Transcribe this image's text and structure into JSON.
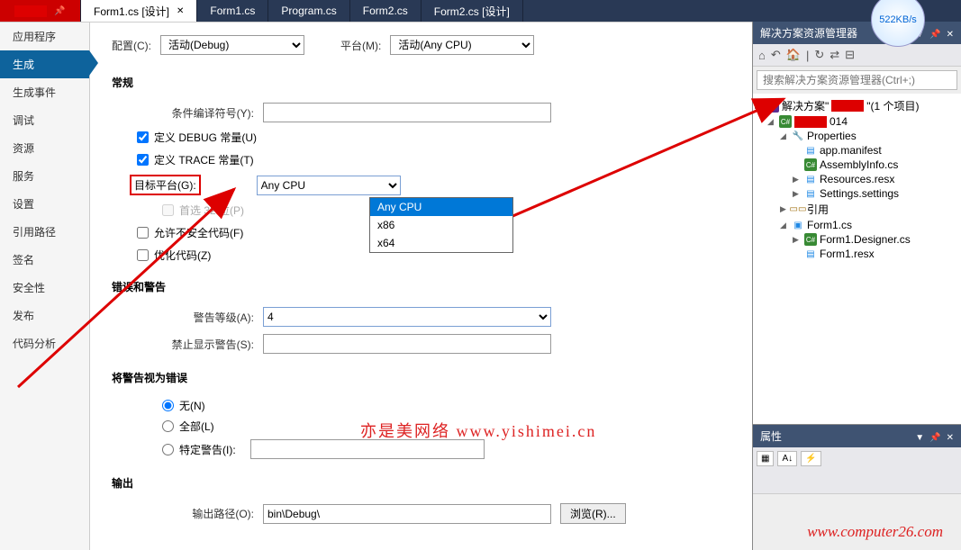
{
  "tabs": {
    "pinned_icon": "⬒",
    "items": [
      {
        "label": "Form1.cs [设计]",
        "active": true
      },
      {
        "label": "Form1.cs"
      },
      {
        "label": "Program.cs"
      },
      {
        "label": "Form2.cs"
      },
      {
        "label": "Form2.cs [设计]"
      }
    ]
  },
  "sidebar": {
    "items": [
      "应用程序",
      "生成",
      "生成事件",
      "调试",
      "资源",
      "服务",
      "设置",
      "引用路径",
      "签名",
      "安全性",
      "发布",
      "代码分析"
    ],
    "selected_index": 1
  },
  "config_bar": {
    "config_label": "配置(C):",
    "config_value": "活动(Debug)",
    "platform_label": "平台(M):",
    "platform_value": "活动(Any CPU)"
  },
  "sections": {
    "general": {
      "title": "常规",
      "cond_label": "条件编译符号(Y):",
      "cond_value": "",
      "define_debug": "定义 DEBUG 常量(U)",
      "define_trace": "定义 TRACE 常量(T)",
      "target_label": "目标平台(G):",
      "target_value": "Any CPU",
      "target_options": [
        "Any CPU",
        "x86",
        "x64"
      ],
      "prefer32": "首选 32 位(P)",
      "allow_unsafe": "允许不安全代码(F)",
      "optimize": "优化代码(Z)"
    },
    "warnings": {
      "title": "错误和警告",
      "level_label": "警告等级(A):",
      "level_value": "4",
      "suppress_label": "禁止显示警告(S):",
      "suppress_value": ""
    },
    "treat_as_error": {
      "title": "将警告视为错误",
      "none": "无(N)",
      "all": "全部(L)",
      "specific": "特定警告(I):"
    },
    "output": {
      "title": "输出",
      "path_label": "输出路径(O):",
      "path_value": "bin\\Debug\\",
      "browse": "浏览(R)..."
    }
  },
  "watermark": "亦是美网络 www.yishimei.cn",
  "watermark2": "www.computer26.com",
  "solution_panel": {
    "title": "解决方案资源管理器",
    "search_placeholder": "搜索解决方案资源管理器(Ctrl+;)",
    "solution_prefix": "解决方案\"",
    "solution_suffix": "\"(1 个项目)",
    "project_suffix": "014",
    "nodes": {
      "properties": "Properties",
      "app_manifest": "app.manifest",
      "assembly_info": "AssemblyInfo.cs",
      "resources_resx": "Resources.resx",
      "settings": "Settings.settings",
      "references": "引用",
      "form1cs": "Form1.cs",
      "form1designer": "Form1.Designer.cs",
      "form1resx": "Form1.resx"
    }
  },
  "properties_panel": {
    "title": "属性"
  },
  "speed_badge": "522KB/s"
}
